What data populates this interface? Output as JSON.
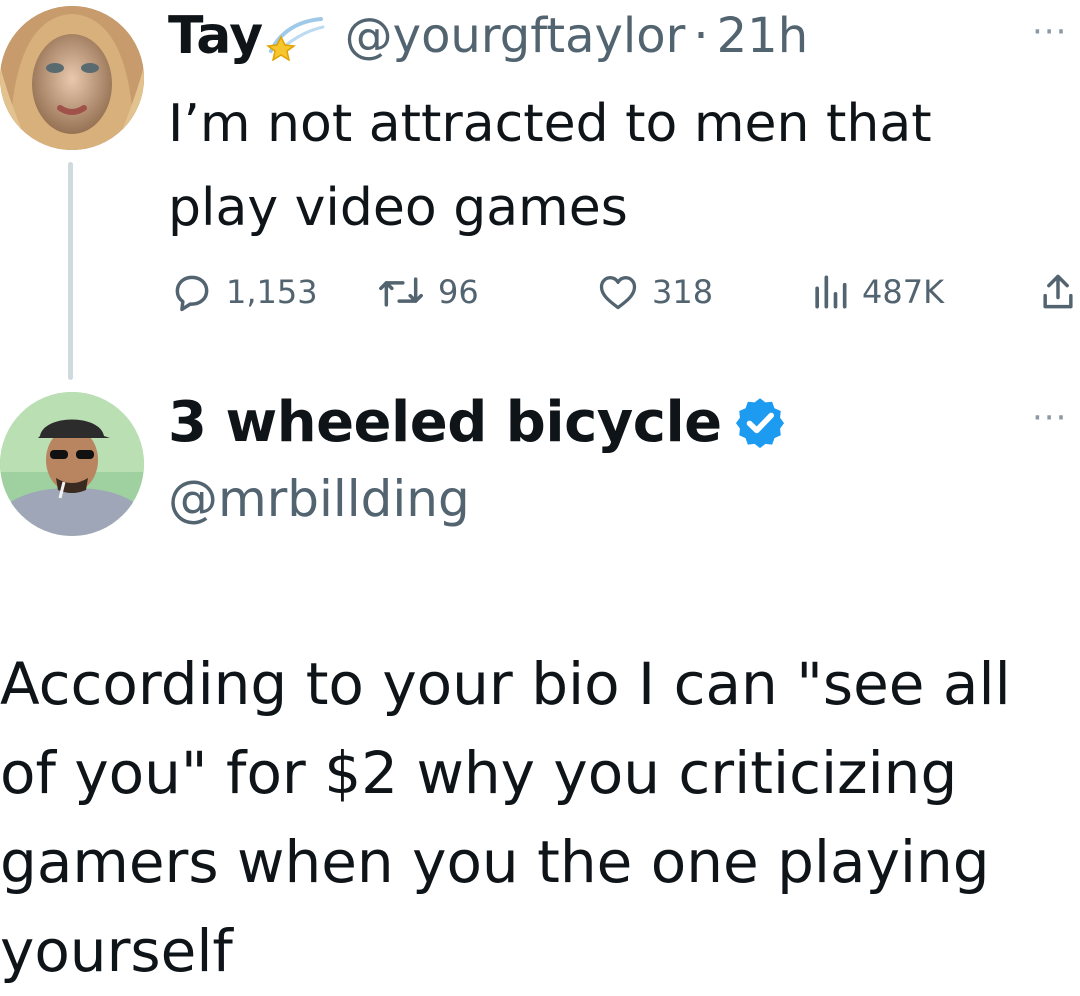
{
  "original_tweet": {
    "author_name": "Tay",
    "handle": "@yourgftaylor",
    "separator": "·",
    "time": "21h",
    "text": "I’m not attracted to men that play video games",
    "more_label": "···",
    "stats": {
      "replies": "1,153",
      "retweets": "96",
      "likes": "318",
      "views": "487K"
    }
  },
  "reply_tweet": {
    "author_name": "3 wheeled bicycle",
    "handle": "@mrbillding",
    "more_label": "···",
    "text": "According to your bio I can \"see all of you\" for $2 why you criticizing gamers when you the one playing yourself"
  },
  "colors": {
    "text_primary": "#0f1419",
    "text_secondary": "#536471",
    "verified_blue": "#1d9bf0",
    "thread_line": "#cfd9de"
  },
  "icons": [
    "comet-emoji-icon",
    "more-icon",
    "reply-icon",
    "retweet-icon",
    "like-icon",
    "views-icon",
    "share-icon",
    "verified-badge-icon"
  ]
}
